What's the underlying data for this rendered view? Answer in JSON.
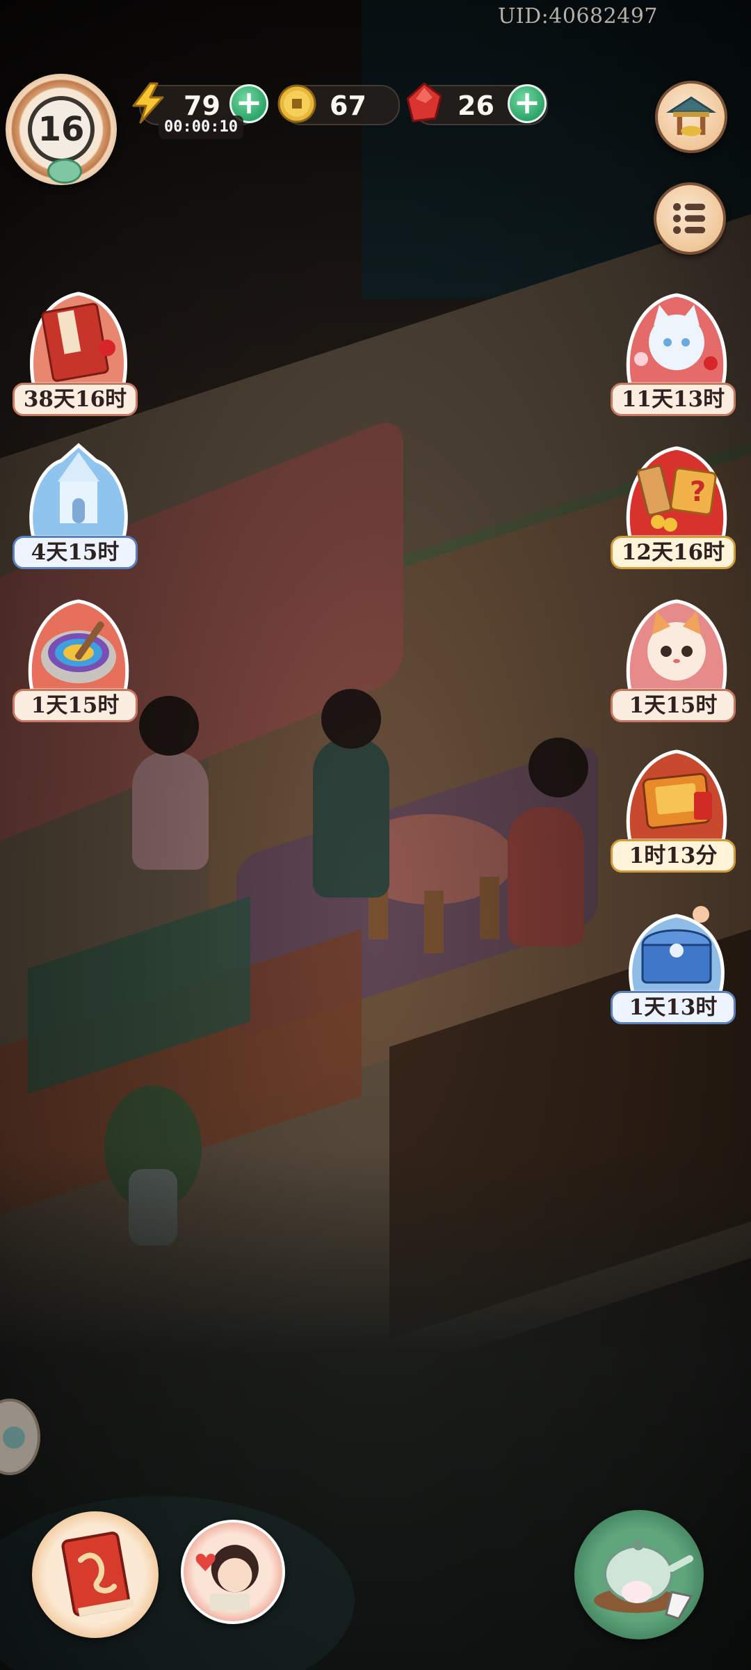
{
  "uid": "UID:40682497",
  "player": {
    "level": "16"
  },
  "resources": {
    "energy": {
      "value": "79",
      "timer": "00:00:10",
      "icon": "lightning-bolt-icon"
    },
    "coins": {
      "value": "67",
      "icon": "copper-coin-icon"
    },
    "gems": {
      "value": "26",
      "icon": "red-gem-icon"
    }
  },
  "top_right": [
    {
      "name": "shop-pavilion-icon"
    },
    {
      "name": "menu-list-icon"
    }
  ],
  "events_left": [
    {
      "icon": "red-book-scroll-icon",
      "time": "38天16时",
      "style": "cream"
    },
    {
      "icon": "ice-palace-icon",
      "time": "4天15时",
      "style": "blue"
    },
    {
      "icon": "rainbow-paint-bowl-icon",
      "time": "1天15时",
      "style": "cream"
    }
  ],
  "events_right": [
    {
      "icon": "white-cat-blossom-icon",
      "time": "11天13时",
      "style": "cream"
    },
    {
      "icon": "mystery-gift-box-icon",
      "time": "12天16时",
      "style": "gold"
    },
    {
      "icon": "orange-cat-icon",
      "time": "1天15时",
      "style": "cream"
    },
    {
      "icon": "red-gold-treasure-box-icon",
      "time": "1时13分",
      "style": "gold"
    },
    {
      "icon": "blue-treasure-chest-icon",
      "time": "1天13时",
      "style": "blue"
    }
  ],
  "bottom": [
    {
      "name": "quest-book-button"
    },
    {
      "name": "character-portrait-button"
    },
    {
      "name": "teapot-rabbit-button"
    },
    {
      "name": "side-tab-cat-icon"
    }
  ],
  "colors": {
    "plus_green": "#2ea56a",
    "pill_cream": "#fbeee0",
    "pill_border_red": "#c9775e",
    "pill_blue_border": "#5a7fc0"
  }
}
